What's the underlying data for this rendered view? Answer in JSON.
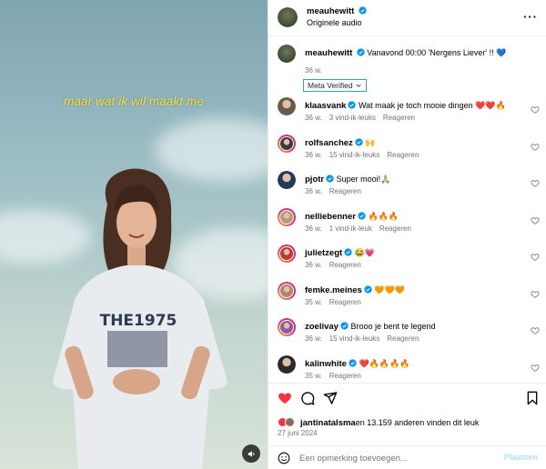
{
  "post": {
    "username": "meauhewitt",
    "subtitle": "Originele audio",
    "caption_username": "meauhewitt",
    "caption_text": "Vanavond 00:00 'Nergens Liever' !! 💙",
    "caption_time": "36 w.",
    "meta_verified_label": "Meta Verified"
  },
  "video": {
    "subtitle_text": "maar wat ik wil maakt me"
  },
  "comments": [
    {
      "username": "klaasvank",
      "text": "Wat maak je toch mooie dingen ❤️❤️🔥",
      "time": "36 w.",
      "likes": "3 vind-ik-leuks",
      "reply": "Reageren",
      "avatar_color": "#6b5a4a"
    },
    {
      "username": "rolfsanchez",
      "text": "🙌",
      "time": "36 w.",
      "likes": "15 vind-ik-leuks",
      "reply": "Reageren",
      "avatar_color": "#3a3a3a"
    },
    {
      "username": "pjotr",
      "text": "Super mooi!🙏🏼",
      "time": "36 w.",
      "likes": "",
      "reply": "Reageren",
      "avatar_color": "#1f3a5a"
    },
    {
      "username": "nelliebenner",
      "text": "🔥🔥🔥",
      "time": "36 w.",
      "likes": "1 vind-ik-leuk",
      "reply": "Reageren",
      "avatar_color": "#b89a7a"
    },
    {
      "username": "julietzegt",
      "text": "😂💗",
      "time": "36 w.",
      "likes": "",
      "reply": "Reageren",
      "avatar_color": "#c0392b"
    },
    {
      "username": "femke.meines",
      "text": "🧡🧡🧡",
      "time": "35 w.",
      "likes": "",
      "reply": "Reageren",
      "avatar_color": "#a88a6a"
    },
    {
      "username": "zoelivay",
      "text": "Brooo je bent te legend",
      "time": "36 w.",
      "likes": "15 vind-ik-leuks",
      "reply": "Reageren",
      "avatar_color": "#8e5a9e"
    },
    {
      "username": "kalinwhite",
      "text": "❤️🔥🔥🔥🔥",
      "time": "35 w.",
      "likes": "",
      "reply": "Reageren",
      "avatar_color": "#2a2a2a"
    }
  ],
  "likes": {
    "liked_by": "jantinatalsma",
    "others_text": " en 13.159 anderen vinden dit leuk"
  },
  "date": "27 juni 2024",
  "comment_box": {
    "placeholder": "Een opmerking toevoegen...",
    "post_label": "Plaatsen"
  },
  "colors": {
    "like_red": "#ff3040",
    "verified_blue": "#0095f6",
    "caption_yellow": "#f5e23a"
  },
  "icons": {
    "like": "heart-filled-icon",
    "comment": "comment-icon",
    "share": "share-icon",
    "save": "bookmark-icon",
    "mute": "speaker-icon",
    "more": "more-options-icon",
    "emoji": "emoji-icon"
  }
}
